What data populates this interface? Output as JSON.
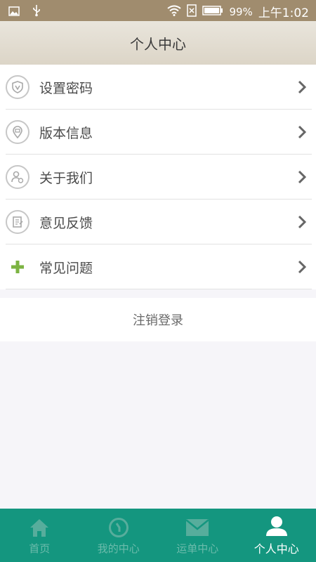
{
  "status_bar": {
    "battery": "99%",
    "time": "上午1:02"
  },
  "header": {
    "title": "个人中心"
  },
  "menu": {
    "items": [
      {
        "label": "设置密码",
        "icon": "shield-icon"
      },
      {
        "label": "版本信息",
        "icon": "location-pin-icon"
      },
      {
        "label": "关于我们",
        "icon": "people-icon"
      },
      {
        "label": "意见反馈",
        "icon": "clipboard-icon"
      },
      {
        "label": "常见问题",
        "icon": "plus-icon"
      }
    ]
  },
  "logout_label": "注销登录",
  "bottom_nav": {
    "items": [
      {
        "label": "首页",
        "icon": "home-icon"
      },
      {
        "label": "我的中心",
        "icon": "clock-icon"
      },
      {
        "label": "运单中心",
        "icon": "mail-icon"
      },
      {
        "label": "个人中心",
        "icon": "person-icon"
      }
    ],
    "active_index": 3
  },
  "colors": {
    "status_bar": "#a08c6e",
    "nav_bg": "#14967f",
    "accent_plus": "#7cb342"
  }
}
